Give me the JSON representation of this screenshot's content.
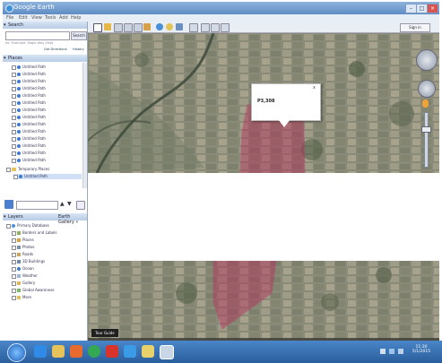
{
  "window": {
    "title": "Google Earth",
    "controls": [
      "–",
      "□",
      "×"
    ]
  },
  "menu": [
    "File",
    "Edit",
    "View",
    "Tools",
    "Add",
    "Help"
  ],
  "search": {
    "header": "Search",
    "button": "Search",
    "hint": "ex: Example: Eagle Way Vista",
    "get_directions": "Get Directions",
    "history": "History"
  },
  "places": {
    "header": "Places",
    "items": [
      "Untitled Path",
      "Untitled Path",
      "Untitled Path",
      "Untitled Path",
      "Untitled Path",
      "Untitled Path",
      "Untitled Path",
      "Untitled Path",
      "Untitled Path",
      "Untitled Path",
      "Untitled Path",
      "Untitled Path",
      "Untitled Path",
      "Untitled Path"
    ],
    "temporary": "Temporary Places",
    "temp_item": "Untitled Path"
  },
  "layers": {
    "header": "Layers",
    "gallery": "Earth Gallery »",
    "items": [
      "Primary Database",
      "Borders and Labels",
      "Places",
      "Photos",
      "Roads",
      "3D Buildings",
      "Ocean",
      "Weather",
      "Gallery",
      "Global Awareness",
      "More"
    ]
  },
  "signin": "Sign in",
  "popup": {
    "label": "P3,308",
    "close": "x"
  },
  "map": {
    "footer_button": "Tour Guide"
  },
  "tray": {
    "time": "11:30",
    "date": "5/1/2015"
  },
  "colors": {
    "accent": "#3a7bd5",
    "polygon": "#b42d5a"
  }
}
